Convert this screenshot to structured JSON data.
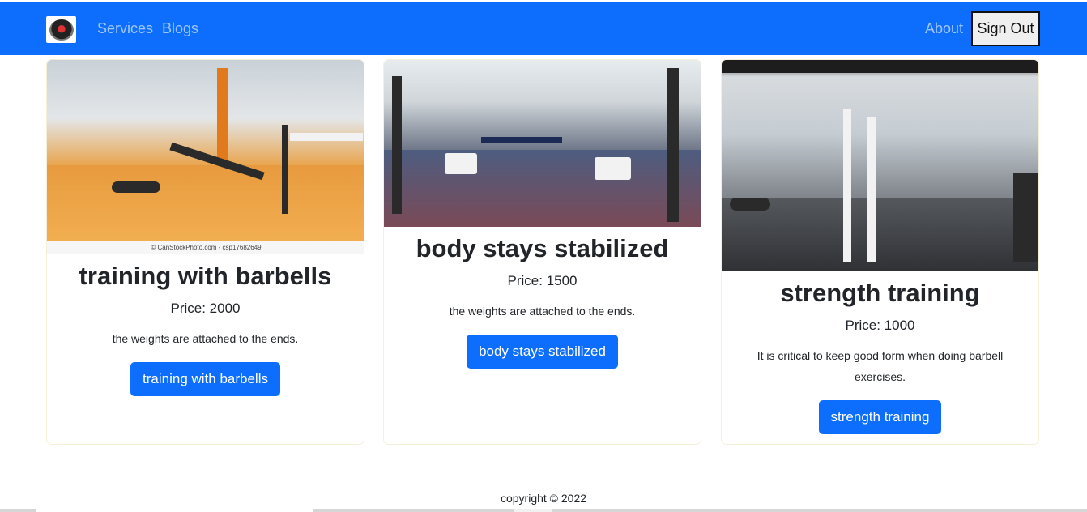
{
  "nav": {
    "logo_icon": "gym-logo-icon",
    "links": [
      "Services",
      "Blogs"
    ],
    "about": "About",
    "sign_out": "Sign Out"
  },
  "cards": [
    {
      "title": "training with barbells",
      "price": "Price: 2000",
      "description": "the weights are attached to the ends.",
      "button": "training with barbells",
      "image_caption": "© CanStockPhoto.com - csp17682649"
    },
    {
      "title": "body stays stabilized",
      "price": "Price: 1500",
      "description": "the weights are attached to the ends.",
      "button": "body stays stabilized"
    },
    {
      "title": "strength training",
      "price": "Price: 1000",
      "description": "It is critical to keep good form when doing barbell exercises.",
      "button": "strength training"
    }
  ],
  "footer": {
    "copyright": "copyright © 2022"
  },
  "colors": {
    "primary": "#0d6efd",
    "button_text": "#ffffff"
  }
}
